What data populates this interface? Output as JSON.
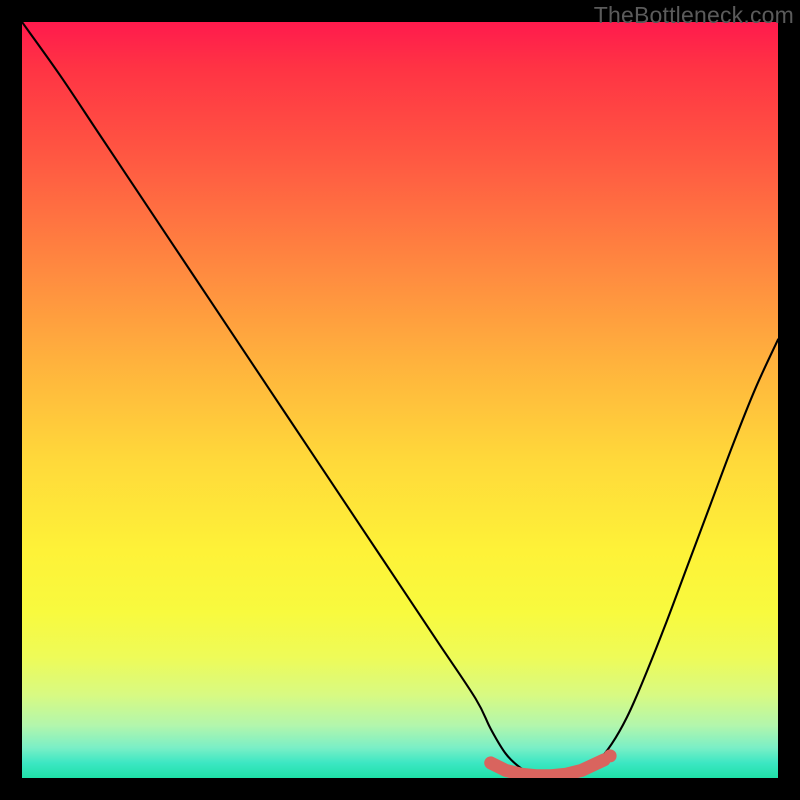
{
  "watermark": "TheBottleneck.com",
  "colors": {
    "curve_stroke": "#000000",
    "marker_fill": "#d9645e",
    "marker_stroke": "#d9645e"
  },
  "chart_data": {
    "type": "line",
    "title": "",
    "xlabel": "",
    "ylabel": "",
    "xlim": [
      0,
      100
    ],
    "ylim": [
      0,
      100
    ],
    "series": [
      {
        "name": "bottleneck-curve",
        "x": [
          0,
          5,
          10,
          15,
          20,
          25,
          30,
          35,
          40,
          45,
          50,
          55,
          60,
          62,
          64,
          66,
          68,
          70,
          72,
          74,
          76,
          78,
          80,
          82,
          85,
          88,
          91,
          94,
          97,
          100
        ],
        "y": [
          100,
          93,
          85.5,
          78,
          70.5,
          63,
          55.5,
          48,
          40.5,
          33,
          25.5,
          18,
          10.5,
          6.5,
          3.2,
          1.3,
          0.3,
          0,
          0.1,
          0.6,
          2.0,
          4.5,
          8.0,
          12.5,
          20.0,
          28.0,
          36.0,
          44.0,
          51.5,
          58.0
        ]
      }
    ],
    "markers": [
      {
        "x": 62,
        "y": 2.0
      },
      {
        "x": 64,
        "y": 1.0
      },
      {
        "x": 66,
        "y": 0.5
      },
      {
        "x": 68,
        "y": 0.3
      },
      {
        "x": 70,
        "y": 0.3
      },
      {
        "x": 72,
        "y": 0.5
      },
      {
        "x": 74,
        "y": 1.0
      },
      {
        "x": 77,
        "y": 2.4
      }
    ]
  }
}
